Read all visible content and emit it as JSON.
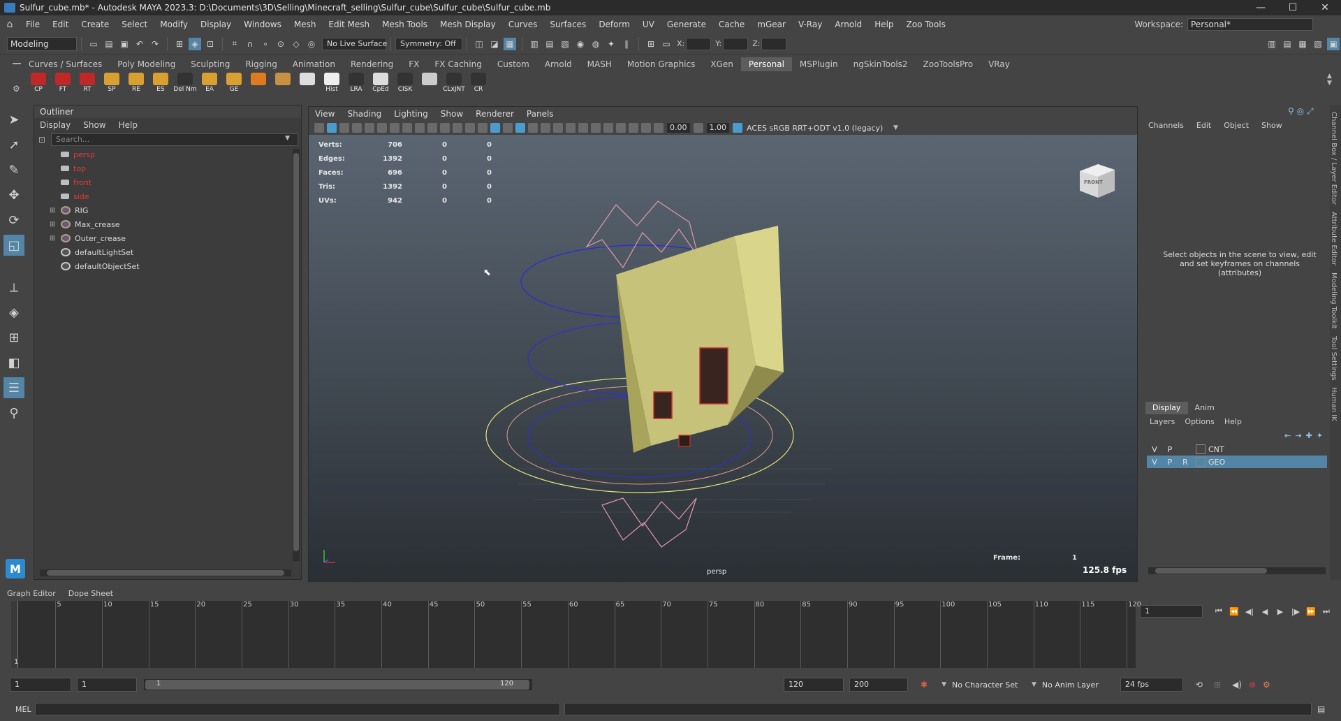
{
  "window": {
    "title": "Sulfur_cube.mb* - Autodesk MAYA 2023.3: D:\\Documents\\3D\\Selling\\Minecraft_selling\\Sulfur_cube\\Sulfur_cube\\Sulfur_cube.mb",
    "min": "—",
    "max": "☐",
    "close": "✕"
  },
  "menus": [
    "File",
    "Edit",
    "Create",
    "Select",
    "Modify",
    "Display",
    "Windows",
    "Mesh",
    "Edit Mesh",
    "Mesh Tools",
    "Mesh Display",
    "Curves",
    "Surfaces",
    "Deform",
    "UV",
    "Generate",
    "Cache",
    "mGear",
    "V-Ray",
    "Arnold",
    "Help",
    "Zoo Tools"
  ],
  "workspace": {
    "label": "Workspace:",
    "value": "Personal*"
  },
  "statusline": {
    "mode": "Modeling",
    "live_surface": "No Live Surface",
    "symmetry": "Symmetry: Off",
    "x_label": "X:",
    "y_label": "Y:",
    "z_label": "Z:"
  },
  "shelf": {
    "tabs": [
      "Curves / Surfaces",
      "Poly Modeling",
      "Sculpting",
      "Rigging",
      "Animation",
      "Rendering",
      "FX",
      "FX Caching",
      "Custom",
      "Arnold",
      "MASH",
      "Motion Graphics",
      "XGen",
      "Personal",
      "MSPlugin",
      "ngSkinTools2",
      "ZooToolsPro",
      "VRay"
    ],
    "active_tab": "Personal",
    "icons": [
      {
        "label": "CP",
        "color": "#c02828"
      },
      {
        "label": "FT",
        "color": "#c02828"
      },
      {
        "label": "RT",
        "color": "#c02828"
      },
      {
        "label": "SP",
        "color": "#d8a030"
      },
      {
        "label": "RE",
        "color": "#d8a030"
      },
      {
        "label": "ES",
        "color": "#d8a030"
      },
      {
        "label": "Del Nm",
        "color": "#333333"
      },
      {
        "label": "EA",
        "color": "#d8a030"
      },
      {
        "label": "GE",
        "color": "#d8a030"
      },
      {
        "label": "",
        "color": "#e07a20"
      },
      {
        "label": "",
        "color": "#c89040"
      },
      {
        "label": "",
        "color": "#dddddd"
      },
      {
        "label": "Hist",
        "color": "#eeeeee"
      },
      {
        "label": "LRA",
        "color": "#333333"
      },
      {
        "label": "CpEd",
        "color": "#dddddd"
      },
      {
        "label": "CISK",
        "color": "#333333"
      },
      {
        "label": "",
        "color": "#cccccc"
      },
      {
        "label": "CLxJNT",
        "color": "#333333"
      },
      {
        "label": "CR",
        "color": "#333333"
      }
    ]
  },
  "outliner": {
    "title": "Outliner",
    "menu": [
      "Display",
      "Show",
      "Help"
    ],
    "search_placeholder": "Search...",
    "items": [
      {
        "label": "persp",
        "type": "camera",
        "red": true,
        "expandable": false
      },
      {
        "label": "top",
        "type": "camera",
        "red": true,
        "expandable": false
      },
      {
        "label": "front",
        "type": "camera",
        "red": true,
        "expandable": false
      },
      {
        "label": "side",
        "type": "camera",
        "red": true,
        "expandable": false
      },
      {
        "label": "RIG",
        "type": "group",
        "red": false,
        "expandable": true
      },
      {
        "label": "Max_crease",
        "type": "group",
        "red": false,
        "expandable": true
      },
      {
        "label": "Outer_crease",
        "type": "group",
        "red": false,
        "expandable": true
      },
      {
        "label": "defaultLightSet",
        "type": "set",
        "red": false,
        "expandable": false
      },
      {
        "label": "defaultObjectSet",
        "type": "set",
        "red": false,
        "expandable": false
      }
    ]
  },
  "viewport": {
    "menu": [
      "View",
      "Shading",
      "Lighting",
      "Show",
      "Renderer",
      "Panels"
    ],
    "exposure": "0.00",
    "gamma": "1.00",
    "color_space": "ACES sRGB RRT+ODT v1.0 (legacy)",
    "hud": [
      {
        "label": "Verts:",
        "v": "706",
        "a": "0",
        "b": "0"
      },
      {
        "label": "Edges:",
        "v": "1392",
        "a": "0",
        "b": "0"
      },
      {
        "label": "Faces:",
        "v": "696",
        "a": "0",
        "b": "0"
      },
      {
        "label": "Tris:",
        "v": "1392",
        "a": "0",
        "b": "0"
      },
      {
        "label": "UVs:",
        "v": "942",
        "a": "0",
        "b": "0"
      }
    ],
    "frame_label": "Frame:",
    "frame_value": "1",
    "fps": "125.8 fps",
    "camera": "persp",
    "viewcube_label": "FRONT"
  },
  "channelbox": {
    "menu": [
      "Channels",
      "Edit",
      "Object",
      "Show"
    ],
    "message": "Select objects in the scene to view, edit and set keyframes on channels (attributes)"
  },
  "layers": {
    "tabs": [
      "Display",
      "Anim"
    ],
    "menu": [
      "Layers",
      "Options",
      "Help"
    ],
    "rows": [
      {
        "v": "V",
        "p": "P",
        "r": "",
        "name": "CNT",
        "selected": false
      },
      {
        "v": "V",
        "p": "P",
        "r": "R",
        "name": "GEO",
        "selected": true
      }
    ]
  },
  "right_tabs": [
    "Channel Box / Layer Editor",
    "Attribute Editor",
    "Modeling Toolkit",
    "Tool Settings",
    "Human IK"
  ],
  "timeline": {
    "tabs": [
      "Graph Editor",
      "Dope Sheet"
    ],
    "ticks": [
      5,
      10,
      15,
      20,
      25,
      30,
      35,
      40,
      45,
      50,
      55,
      60,
      65,
      70,
      75,
      80,
      85,
      90,
      95,
      100,
      105,
      110,
      115,
      120
    ],
    "current_frame": "1",
    "current_field": "1"
  },
  "range": {
    "start": "1",
    "start2": "1",
    "slider_lo": "1",
    "slider_hi": "120",
    "end": "120",
    "end2": "200",
    "character_set": "No Character Set",
    "anim_layer": "No Anim Layer",
    "fps": "24 fps"
  },
  "cmdline": {
    "label": "MEL"
  }
}
